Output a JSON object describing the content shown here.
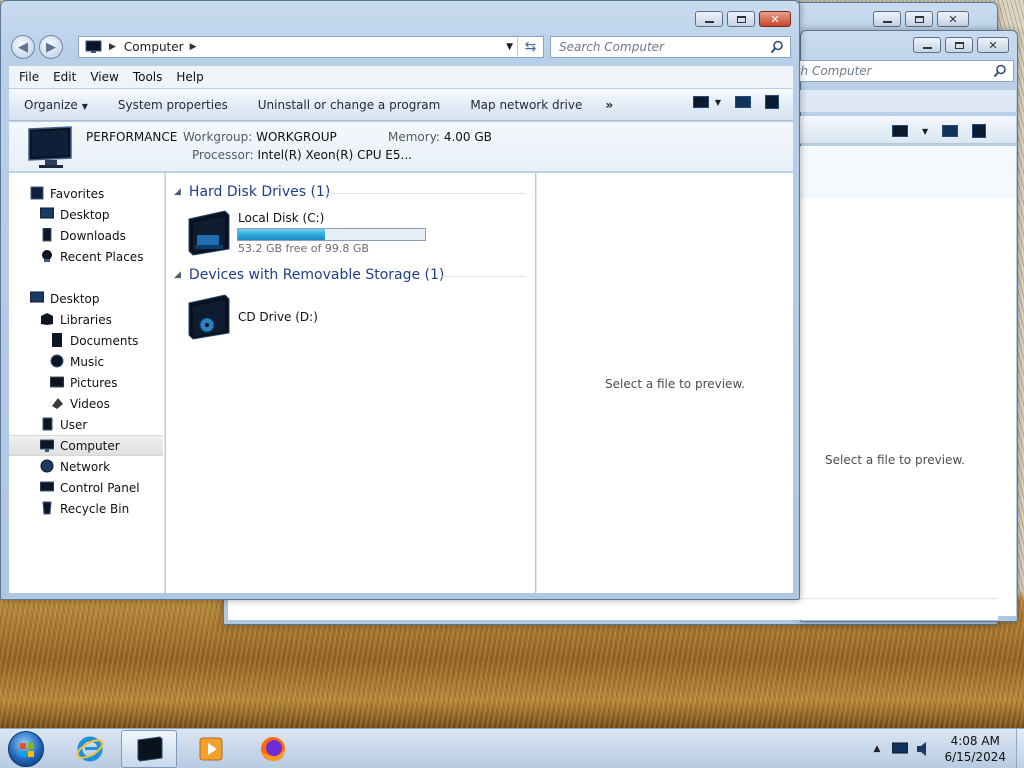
{
  "bg_window": {
    "search_placeholder": "rch Computer",
    "preview_text": "Select a file to preview."
  },
  "main_window": {
    "address": {
      "crumb": "Computer"
    },
    "search_placeholder": "Search Computer",
    "menu": [
      "File",
      "Edit",
      "View",
      "Tools",
      "Help"
    ],
    "commands": {
      "organize": "Organize",
      "system_properties": "System properties",
      "uninstall": "Uninstall or change a program",
      "map_drive": "Map network drive",
      "more": "»"
    },
    "info": {
      "computer_name": "PERFORMANCE",
      "workgroup_label": "Workgroup:",
      "workgroup_value": "WORKGROUP",
      "memory_label": "Memory:",
      "memory_value": "4.00 GB",
      "processor_label": "Processor:",
      "processor_value": "Intel(R) Xeon(R) CPU E5..."
    },
    "nav": {
      "favorites": "Favorites",
      "desktop_fav": "Desktop",
      "downloads": "Downloads",
      "recent": "Recent Places",
      "desktop": "Desktop",
      "libraries": "Libraries",
      "documents": "Documents",
      "music": "Music",
      "pictures": "Pictures",
      "videos": "Videos",
      "user": "User",
      "computer": "Computer",
      "network": "Network",
      "control_panel": "Control Panel",
      "recycle_bin": "Recycle Bin"
    },
    "groups": {
      "hdd_title": "Hard Disk Drives (1)",
      "removable_title": "Devices with Removable Storage (1)"
    },
    "drives": {
      "c_name": "Local Disk (C:)",
      "c_free": "53.2 GB free of 99.8 GB",
      "c_used_fraction": 0.467,
      "d_name": "CD Drive (D:)"
    },
    "preview_text": "Select a file to preview."
  },
  "taskbar": {
    "time": "4:08 AM",
    "date": "6/15/2024"
  },
  "colors": {
    "accent": "#1e3e8a",
    "bar_fill": "#2aa2d7",
    "close_button": "#c7452c"
  }
}
